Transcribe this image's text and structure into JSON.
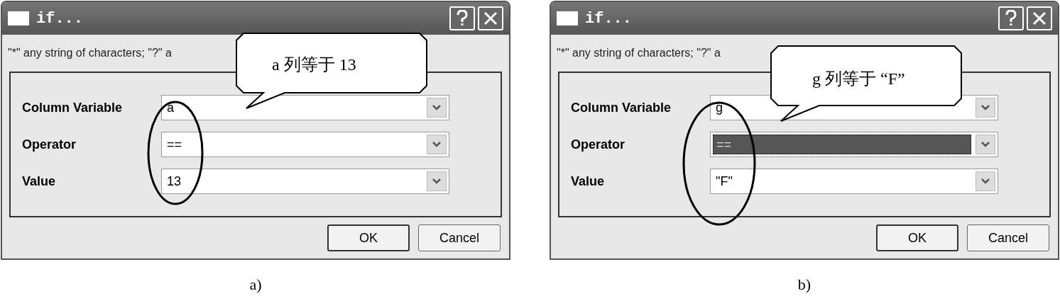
{
  "panels": [
    {
      "title": "if...",
      "hint": "\"*\" any string of characters; \"?\" a",
      "fields": [
        {
          "label": "Column Variable",
          "value": "a",
          "selected": false
        },
        {
          "label": "Operator",
          "value": "==",
          "selected": false
        },
        {
          "label": "Value",
          "value": "13",
          "selected": false
        }
      ],
      "buttons": [
        "OK",
        "Cancel"
      ],
      "callout": "a 列等于 13",
      "caption": "a)"
    },
    {
      "title": "if...",
      "hint": "\"*\" any string of characters; \"?\" a",
      "fields": [
        {
          "label": "Column Variable",
          "value": "g",
          "selected": false
        },
        {
          "label": "Operator",
          "value": "==",
          "selected": true
        },
        {
          "label": "Value",
          "value": "\"F\"",
          "selected": false
        }
      ],
      "buttons": [
        "OK",
        "Cancel"
      ],
      "callout": "g 列等于 “F”",
      "caption": "b)"
    }
  ]
}
